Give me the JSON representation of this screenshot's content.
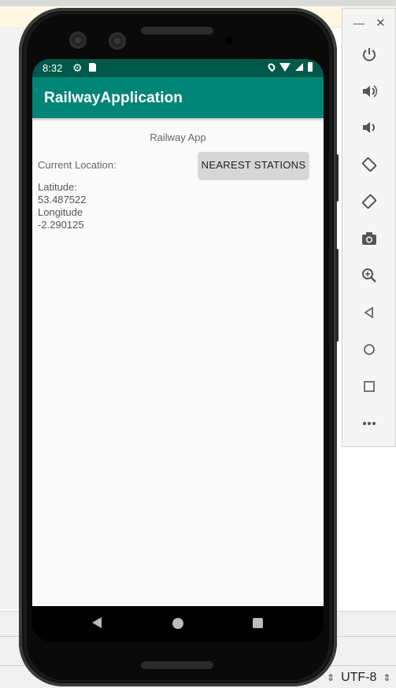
{
  "app": {
    "title": "RailwayApplication",
    "header_label": "Railway App",
    "current_location_label": "Current Location:",
    "nearest_button_label": "NEAREST STATIONS",
    "latitude_label": "Latitude:",
    "latitude_value": "53.487522",
    "longitude_label": "Longitude",
    "longitude_value": "-2.290125"
  },
  "statusbar": {
    "time": "8:32"
  },
  "ide": {
    "encoding": "UTF-8"
  },
  "emulator_toolbar": {
    "buttons": [
      "power-icon",
      "volume-up-icon",
      "volume-down-icon",
      "rotate-left-icon",
      "rotate-right-icon",
      "camera-icon",
      "zoom-icon",
      "back-icon",
      "home-icon",
      "overview-icon",
      "more-icon"
    ]
  },
  "colors": {
    "app_bar": "#008577",
    "status_bar": "#00584a",
    "button_bg": "#d6d6d6"
  }
}
